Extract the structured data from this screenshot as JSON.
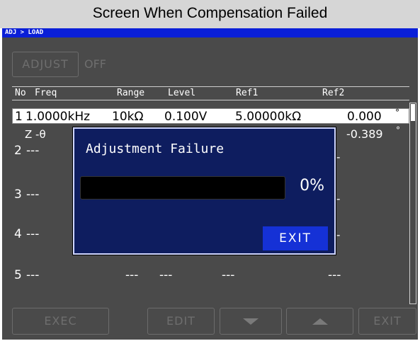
{
  "caption": "Screen When Compensation Failed",
  "titlebar": {
    "breadcrumb": "ADJ > LOAD"
  },
  "adjust": {
    "button_label": "ADJUST",
    "state": "OFF"
  },
  "table": {
    "headers": {
      "no": "No",
      "freq": "Freq",
      "range": "Range",
      "level": "Level",
      "ref1": "Ref1",
      "ref2": "Ref2"
    },
    "rows": [
      {
        "no": "1",
        "freq": "1.0000kHz",
        "range": "10kΩ",
        "level": "0.100V",
        "ref1": "5.00000kΩ",
        "ref2": "0.000",
        "unit": "°"
      },
      {
        "no": "2",
        "freq": "---",
        "range": "",
        "level": "",
        "ref1": "",
        "ref2": "-0.389",
        "unit": "°"
      },
      {
        "no": "3",
        "freq": "---"
      },
      {
        "no": "4",
        "freq": "---"
      },
      {
        "no": "5",
        "freq": "---",
        "range": "---",
        "level": "---",
        "ref1": "---",
        "ref2": "---"
      }
    ],
    "row1_sub": "Z -θ"
  },
  "dialog": {
    "title": "Adjustment Failure",
    "progress_percent": 0,
    "progress_label": "0%",
    "exit_label": "EXIT"
  },
  "bottom_buttons": {
    "exec": "EXEC",
    "edit": "EDIT",
    "down": "down-arrow-icon",
    "up": "up-arrow-icon",
    "exit": "EXIT"
  }
}
